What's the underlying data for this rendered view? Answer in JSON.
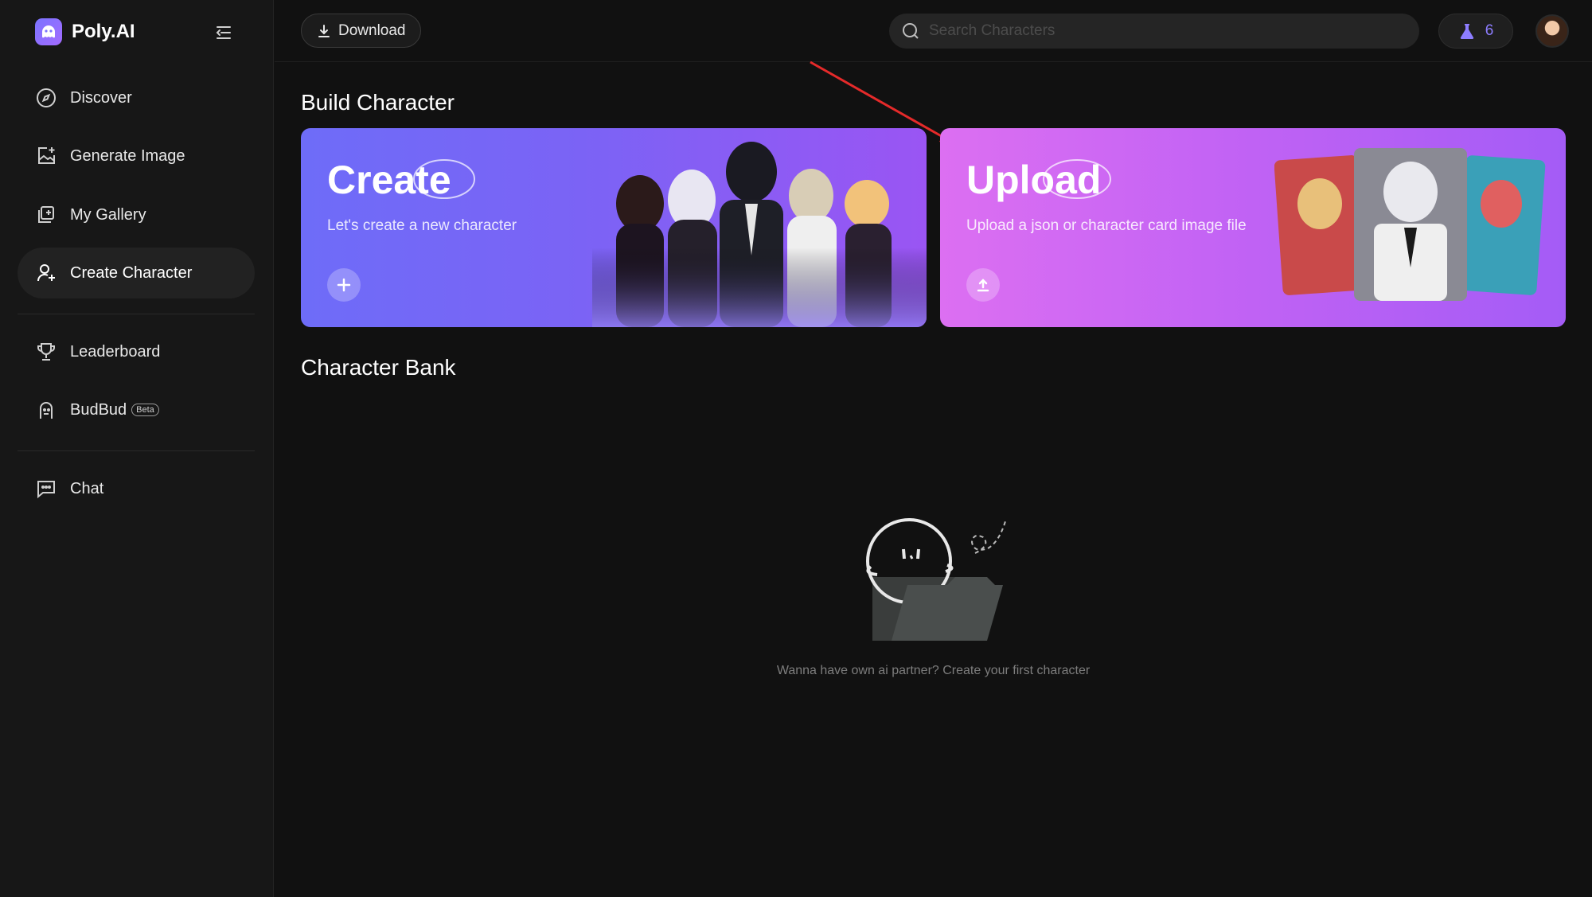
{
  "app": {
    "name": "Poly.AI"
  },
  "sidebar": {
    "items": [
      {
        "label": "Discover",
        "icon": "compass-icon"
      },
      {
        "label": "Generate Image",
        "icon": "image-plus-icon"
      },
      {
        "label": "My Gallery",
        "icon": "gallery-icon"
      },
      {
        "label": "Create Character",
        "icon": "user-plus-icon",
        "active": true
      },
      {
        "label": "Leaderboard",
        "icon": "trophy-icon"
      },
      {
        "label": "BudBud",
        "icon": "budbud-icon",
        "badge": "Beta"
      },
      {
        "label": "Chat",
        "icon": "chat-icon"
      }
    ]
  },
  "header": {
    "download_label": "Download",
    "search_placeholder": "Search Characters",
    "credits": "6"
  },
  "main": {
    "build_title": "Build Character",
    "create_card": {
      "title": "Create",
      "subtitle": "Let's create a new character"
    },
    "upload_card": {
      "title": "Upload",
      "subtitle": "Upload a json or character card image file"
    },
    "bank_title": "Character Bank",
    "empty_text": "Wanna have own ai partner? Create your first character"
  },
  "colors": {
    "accent": "#8d7dff",
    "create_card": "#7b63f5",
    "upload_card": "#d06df3",
    "arrow": "#e52a2a"
  }
}
